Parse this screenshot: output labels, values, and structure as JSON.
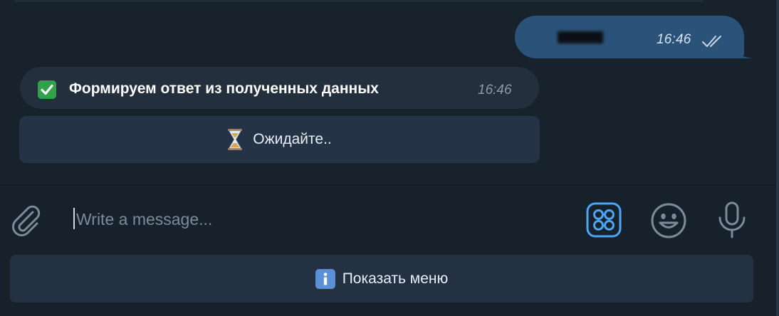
{
  "chat": {
    "outgoing": {
      "time": "16:46",
      "status_icon": "double-check-icon"
    },
    "incoming": {
      "emoji_icon": "check-mark-emoji",
      "text": "Формируем ответ из полученных данных",
      "time": "16:46"
    },
    "inline_keyboard": {
      "emoji_icon": "hourglass-emoji",
      "label": "Ожидайте.."
    }
  },
  "composer": {
    "placeholder": "Write a message...",
    "value": "",
    "icons": {
      "attach": "paperclip-icon",
      "commands": "bot-commands-icon",
      "emoji": "smile-icon",
      "voice": "microphone-icon"
    }
  },
  "reply_keyboard": {
    "emoji_icon": "info-emoji",
    "label": "Показать меню"
  },
  "colors": {
    "background": "#18222d",
    "outgoing_bubble": "#2b5278",
    "incoming_bubble": "#232f3d",
    "button": "#243345",
    "accent": "#4ea4f6"
  }
}
